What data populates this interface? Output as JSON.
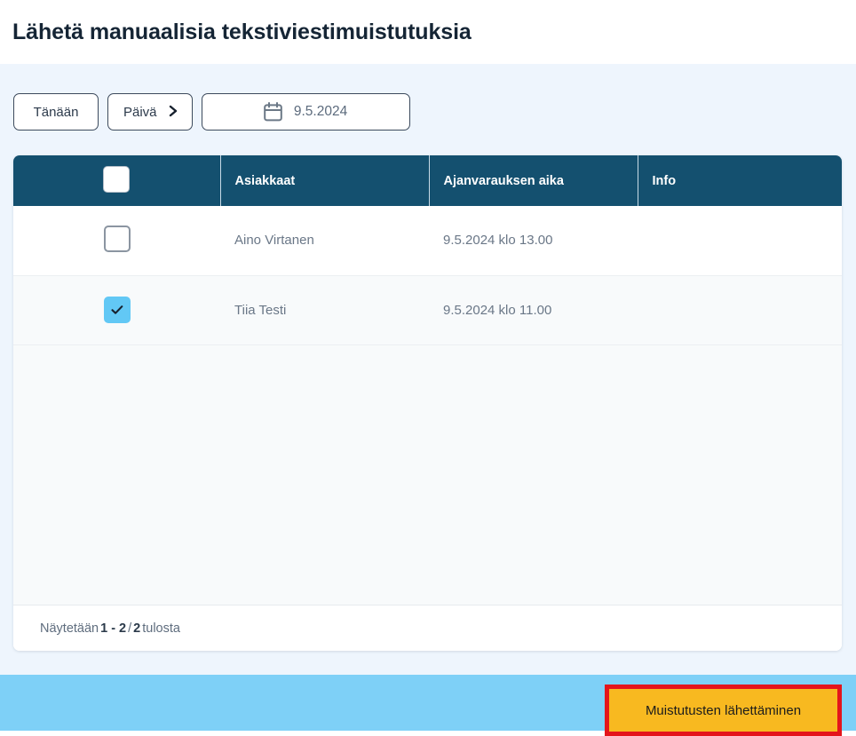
{
  "page": {
    "title": "Lähetä manuaalisia tekstiviestimuistutuksia"
  },
  "toolbar": {
    "today_label": "Tänään",
    "period_label": "Päivä",
    "period_chevron": "chevron-right-icon",
    "date_value": "9.5.2024",
    "calendar_icon": "calendar-icon"
  },
  "table": {
    "select_all_checked": false,
    "columns": [
      {
        "key": "select",
        "label": ""
      },
      {
        "key": "customer",
        "label": "Asiakkaat"
      },
      {
        "key": "time",
        "label": "Ajanvarauksen aika"
      },
      {
        "key": "info",
        "label": "Info"
      }
    ],
    "rows": [
      {
        "checked": false,
        "customer": "Aino Virtanen",
        "time": "9.5.2024 klo 13.00",
        "info": ""
      },
      {
        "checked": true,
        "customer": "Tiia Testi",
        "time": "9.5.2024 klo 11.00",
        "info": ""
      }
    ],
    "footer": {
      "prefix": "Näytetään",
      "range": "1 - 2",
      "separator": "/",
      "total": "2",
      "suffix": "tulosta"
    }
  },
  "action_bar": {
    "send_label": "Muistutusten lähettäminen",
    "highlight_color": "#e4151b",
    "button_color": "#f8b920",
    "bar_color": "#7ed0f7"
  },
  "colors": {
    "header_bg": "#14506f",
    "page_bg": "#eef5fd",
    "title_color": "#152535",
    "checkbox_checked": "#62c8f5"
  }
}
